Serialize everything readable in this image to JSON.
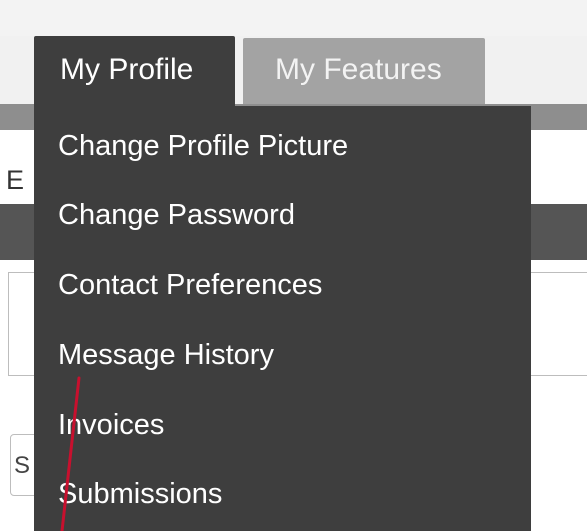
{
  "tabs": {
    "active_label": "My Profile",
    "inactive_label": "My Features"
  },
  "menu": {
    "items": [
      "Change Profile Picture",
      "Change Password",
      "Contact Preferences",
      "Message History",
      "Invoices",
      "Submissions"
    ]
  },
  "background": {
    "letter": "E",
    "select_text": "S"
  },
  "colors": {
    "dropdown_bg": "#3e3e3e",
    "active_tab_bg": "#3e3e3e",
    "inactive_tab_bg": "#a3a3a3",
    "nav_bar": "#8e8e8e",
    "annotation_line": "#c8102e"
  }
}
